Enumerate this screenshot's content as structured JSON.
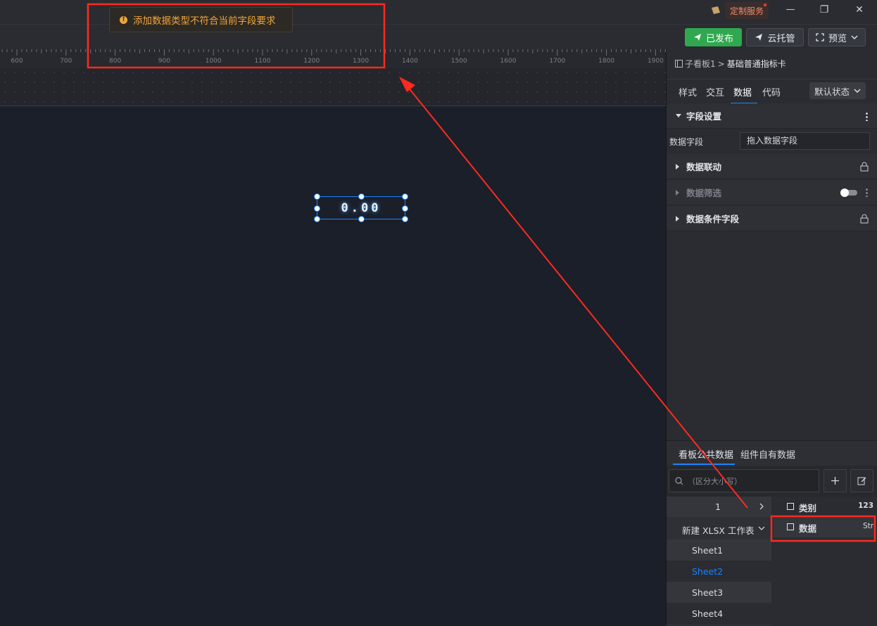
{
  "titlebar": {
    "custom_service": "定制服务",
    "minimize": "—",
    "restore": "❐",
    "close": "✕"
  },
  "toast": {
    "icon": "warning-icon",
    "message": "添加数据类型不符合当前字段要求"
  },
  "toolbar": {
    "publish_label": "已发布",
    "cloud_label": "云托管",
    "preview_label": "预览"
  },
  "ruler": {
    "ticks": [
      "600",
      "700",
      "800",
      "900",
      "1000",
      "1100",
      "1200",
      "1300",
      "1400",
      "1500",
      "1600",
      "1700",
      "1800",
      "1900"
    ]
  },
  "widget": {
    "value": "0.00"
  },
  "panel": {
    "breadcrumb_root": "子看板1",
    "breadcrumb_sep": ">",
    "breadcrumb_current": "基础普通指标卡",
    "tabs": [
      "样式",
      "交互",
      "数据",
      "代码"
    ],
    "active_tab": "数据",
    "state_select": "默认状态",
    "field_settings": "字段设置",
    "data_field_label": "数据字段",
    "data_field_placeholder": "拖入数据字段",
    "data_linkage": "数据联动",
    "data_filter": "数据筛选",
    "data_condition_field": "数据条件字段"
  },
  "data_source": {
    "tabs": [
      "看板公共数据",
      "组件自有数据"
    ],
    "active_tab": "看板公共数据",
    "search_placeholder": "（区分大小写）",
    "tree_item_1": "1",
    "workbook": "新建 XLSX 工作表",
    "sheets": [
      "Sheet1",
      "Sheet2",
      "Sheet3",
      "Sheet4"
    ],
    "selected_sheet": "Sheet2",
    "fields": [
      {
        "name": "类别",
        "type": "123"
      },
      {
        "name": "数据",
        "type": "Str"
      }
    ]
  },
  "colors": {
    "accent": "#1a84ff",
    "publish_green": "#2fa84f",
    "toast_text": "#f0a43a",
    "annotation_red": "#ff2a1f"
  }
}
